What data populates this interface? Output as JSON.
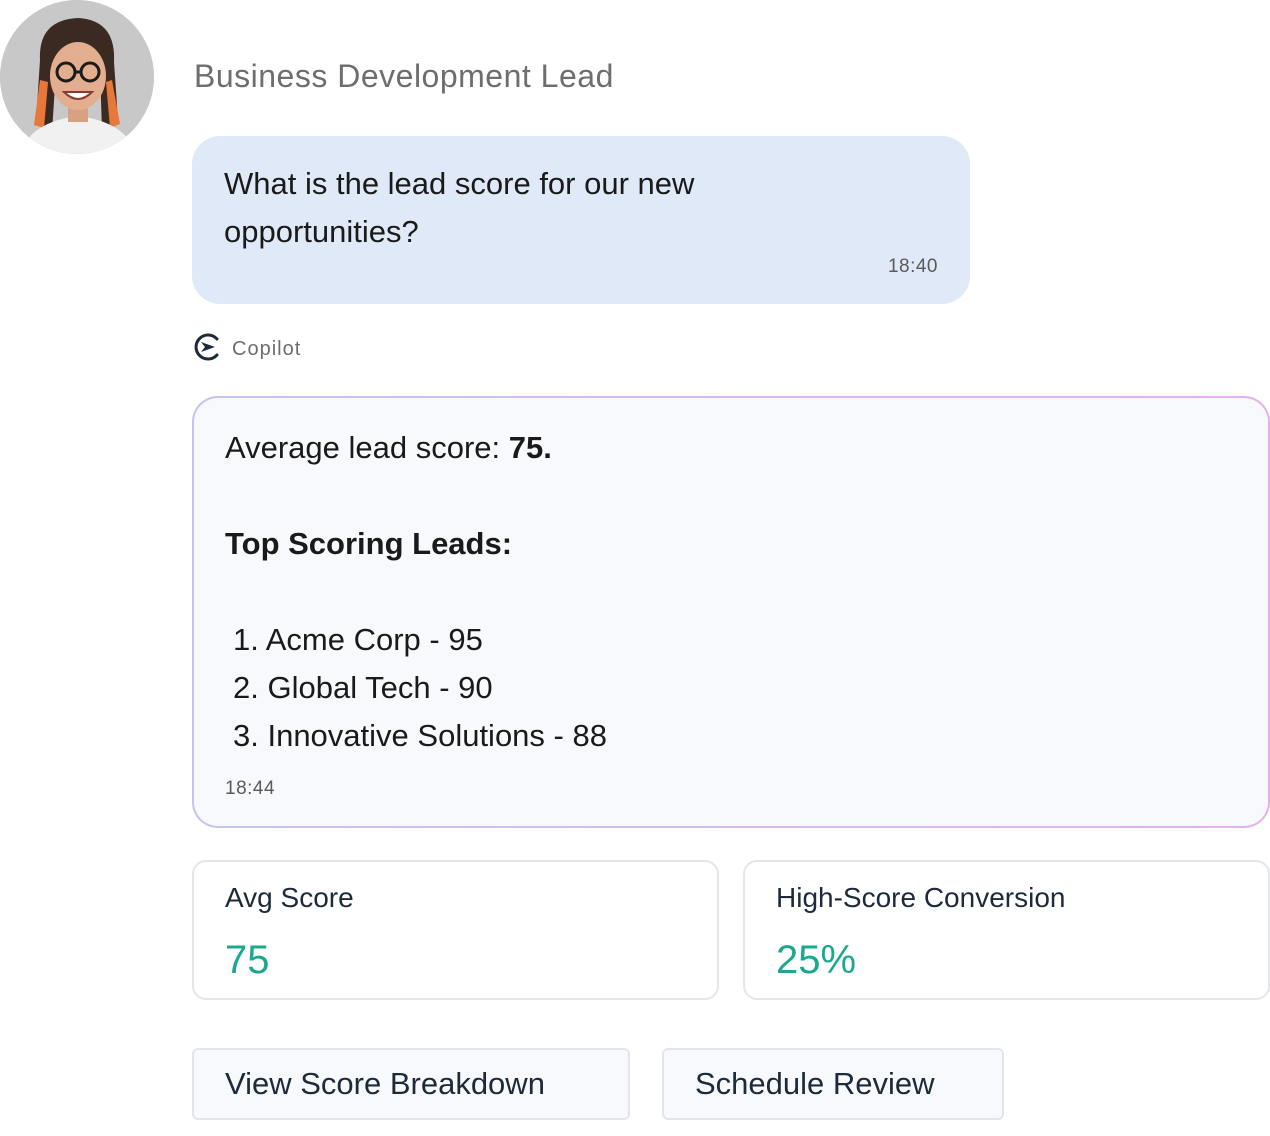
{
  "user": {
    "role": "Business Development Lead",
    "message": "What is the lead score for our new opportunities?",
    "time": "18:40"
  },
  "assistant": {
    "name": "Copilot",
    "icon": "copilot-logo-icon",
    "average_label": "Average lead score: ",
    "average_value": "75.",
    "top_heading": "Top Scoring Leads:",
    "leads": [
      "1. Acme Corp - 95",
      "2. Global Tech - 90",
      "3. Innovative Solutions - 88"
    ],
    "time": "18:44"
  },
  "metrics": [
    {
      "label": "Avg Score",
      "value": "75"
    },
    {
      "label": "High-Score Conversion",
      "value": "25%"
    }
  ],
  "actions": [
    {
      "label": "View Score Breakdown"
    },
    {
      "label": "Schedule Review"
    }
  ],
  "colors": {
    "user_bubble": "#e0e9f8",
    "bot_bubble": "#f8f9fd",
    "metric_value": "#1aa98f",
    "bubble_border_start": "#c4c4ef",
    "bubble_border_end": "#e3b2ec"
  }
}
